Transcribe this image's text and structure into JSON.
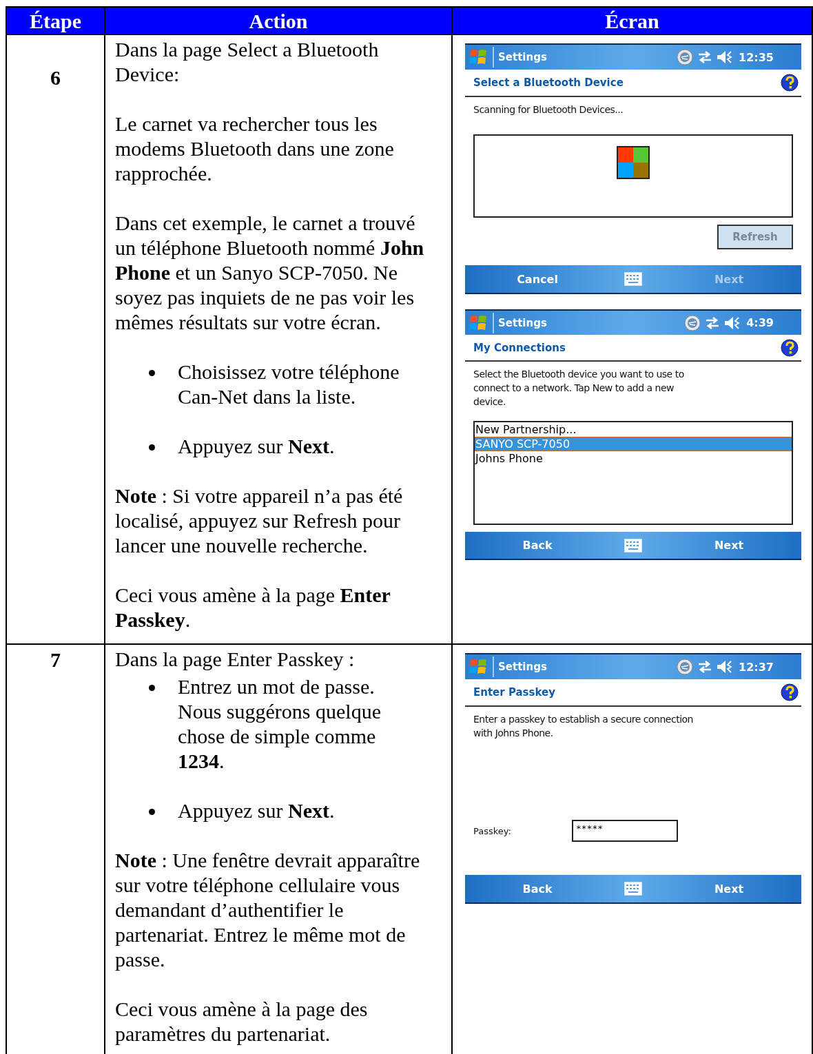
{
  "table": {
    "columns": [
      "Étape",
      "Action",
      "Écran"
    ],
    "rows": [
      {
        "step": "6",
        "action": [
          {
            "kind": "para",
            "text": "Dans la page Select a Bluetooth Device:"
          },
          {
            "kind": "para",
            "text": "Le carnet va rechercher tous les modems Bluetooth dans une zone rapprochée."
          },
          {
            "kind": "para",
            "text": "Dans cet exemple, le carnet a trouvé un téléphone Bluetooth nommé **John Phone** et un Sanyo SCP-7050. Ne soyez pas inquiets de ne pas voir les mêmes résultats sur votre écran."
          },
          {
            "kind": "bullet",
            "text": "Choisissez votre téléphone Can-Net dans la liste."
          },
          {
            "kind": "bullet",
            "text": "Appuyez sur **Next**."
          },
          {
            "kind": "para",
            "text": "**Note** : Si votre appareil n’a pas été localisé, appuyez sur Refresh pour lancer une nouvelle recherche."
          },
          {
            "kind": "para",
            "text": "Ceci vous amène à la page **Enter Passkey**."
          }
        ],
        "screens": [
          {
            "kind": "scanning",
            "app": "Settings",
            "time": "12:35",
            "heading": "Select a Bluetooth Device",
            "message": "Scanning for Bluetooth Devices...",
            "refresh": {
              "label": "Refresh",
              "disabled": true
            },
            "softkeys": [
              {
                "label": "Cancel",
                "disabled": false
              },
              {
                "label": "Next",
                "disabled": true
              }
            ]
          },
          {
            "kind": "list",
            "app": "Settings",
            "time": "4:39",
            "heading": "My Connections",
            "message": "Select the Bluetooth device you want to use to connect to a network. Tap New to add a new device.",
            "items": [
              {
                "label": "New Partnership...",
                "selected": false
              },
              {
                "label": "SANYO SCP-7050",
                "selected": true
              },
              {
                "label": "Johns Phone",
                "selected": false
              }
            ],
            "softkeys": [
              {
                "label": "Back",
                "disabled": false
              },
              {
                "label": "Next",
                "disabled": false
              }
            ]
          }
        ]
      },
      {
        "step": "7",
        "action": [
          {
            "kind": "para",
            "text": "Dans la page Enter Passkey :"
          },
          {
            "kind": "bullet",
            "text": "Entrez un mot de passe. Nous suggérons quelque chose de simple comme **1234**."
          },
          {
            "kind": "bullet",
            "text": "Appuyez sur **Next**."
          },
          {
            "kind": "para",
            "text": "**Note** : Une fenêtre devrait apparaître sur votre téléphone cellulaire vous demandant d’authentifier le partenariat. Entrez le même mot de passe."
          },
          {
            "kind": "para",
            "text": "Ceci vous amène à la page des paramètres du  partenariat."
          }
        ],
        "screens": [
          {
            "kind": "passkey",
            "app": "Settings",
            "time": "12:37",
            "heading": "Enter Passkey",
            "message": "Enter a passkey to establish a secure connection with Johns Phone.",
            "field": {
              "label": "Passkey:",
              "value": "*****"
            },
            "softkeys": [
              {
                "label": "Back",
                "disabled": false
              },
              {
                "label": "Next",
                "disabled": false
              }
            ]
          }
        ]
      }
    ]
  }
}
